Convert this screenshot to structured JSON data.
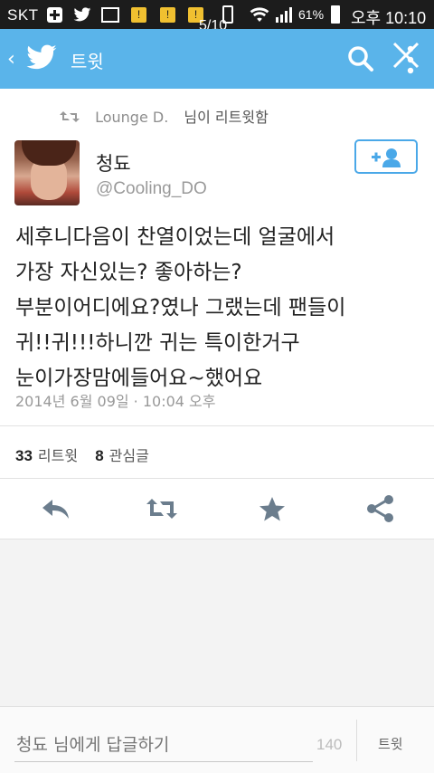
{
  "status_bar": {
    "carrier": "SKT",
    "notif_badge": "!",
    "photo_counter": "5/10",
    "battery": "61%",
    "time": "오후 10:10"
  },
  "header": {
    "title": "트윗",
    "accent_color": "#5ab4ea"
  },
  "retweet": {
    "name": "Lounge D.",
    "suffix": "님이 리트윗함"
  },
  "author": {
    "name": "청됴",
    "handle": "@Cooling_DO"
  },
  "tweet": {
    "text": "세후니다음이 찬열이었는데 얼굴에서\n가장 자신있는? 좋아하는?\n부분이어디에요?였나 그랬는데 팬들이\n귀!!귀!!!하니깐 귀는 특이한거구\n눈이가장맘에들어요~했어요",
    "timestamp": "2014년 6월 09일 · 10:04 오후"
  },
  "stats": {
    "retweets_count": "33",
    "retweets_label": "리트윗",
    "favorites_count": "8",
    "favorites_label": "관심글"
  },
  "actions": {
    "reply": "reply-icon",
    "retweet": "retweet-icon",
    "favorite": "star-icon",
    "share": "share-icon"
  },
  "reply_bar": {
    "placeholder": "청됴 님에게 답글하기",
    "char_count": "140",
    "button_label": "트윗"
  }
}
